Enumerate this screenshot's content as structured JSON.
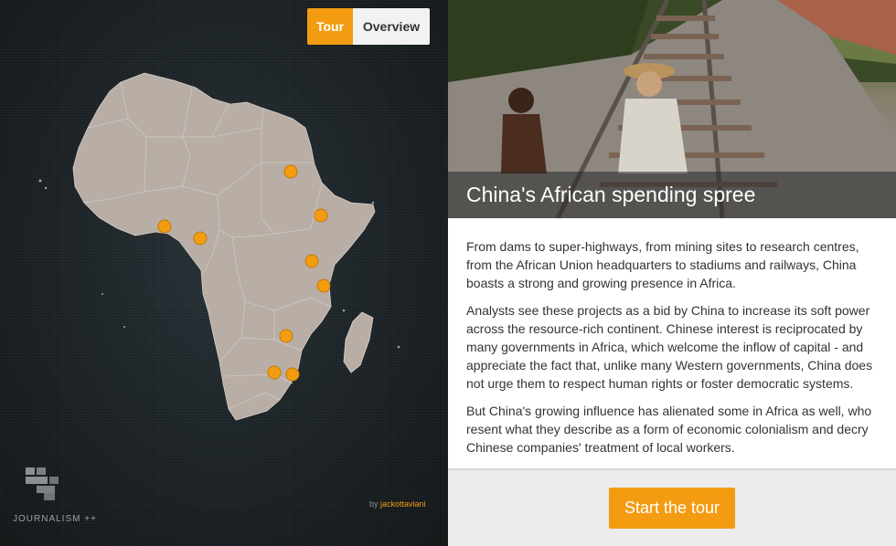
{
  "tabs": {
    "tour_label": "Tour",
    "overview_label": "Overview",
    "active": "Tour"
  },
  "map": {
    "marker_count": 9,
    "marker_color": "#f39c12",
    "land_color": "#b8aea6"
  },
  "branding": {
    "logo_text": "JOURNALISM ++"
  },
  "credit": {
    "prefix": "by",
    "author": "jackottaviani"
  },
  "story": {
    "title": "China's African spending spree",
    "paragraphs": [
      "From dams to super-highways, from mining sites to research centres, from the African Union headquarters to stadiums and railways, China boasts a strong and growing presence in Africa.",
      "Analysts see these projects as a bid by China to increase its soft power across the resource-rich continent. Chinese interest is reciprocated by many governments in Africa, which welcome the inflow of capital - and appreciate the fact that, unlike many Western governments, China does not urge them to respect human rights or foster democratic systems.",
      "But China's growing influence has alienated some in Africa as well, who resent what they describe as a form of economic colonialism and decry Chinese companies' treatment of local workers."
    ],
    "cta_label": "Start the tour"
  },
  "colors": {
    "accent": "#f39c12",
    "panel_bg": "#1a1d1f"
  }
}
